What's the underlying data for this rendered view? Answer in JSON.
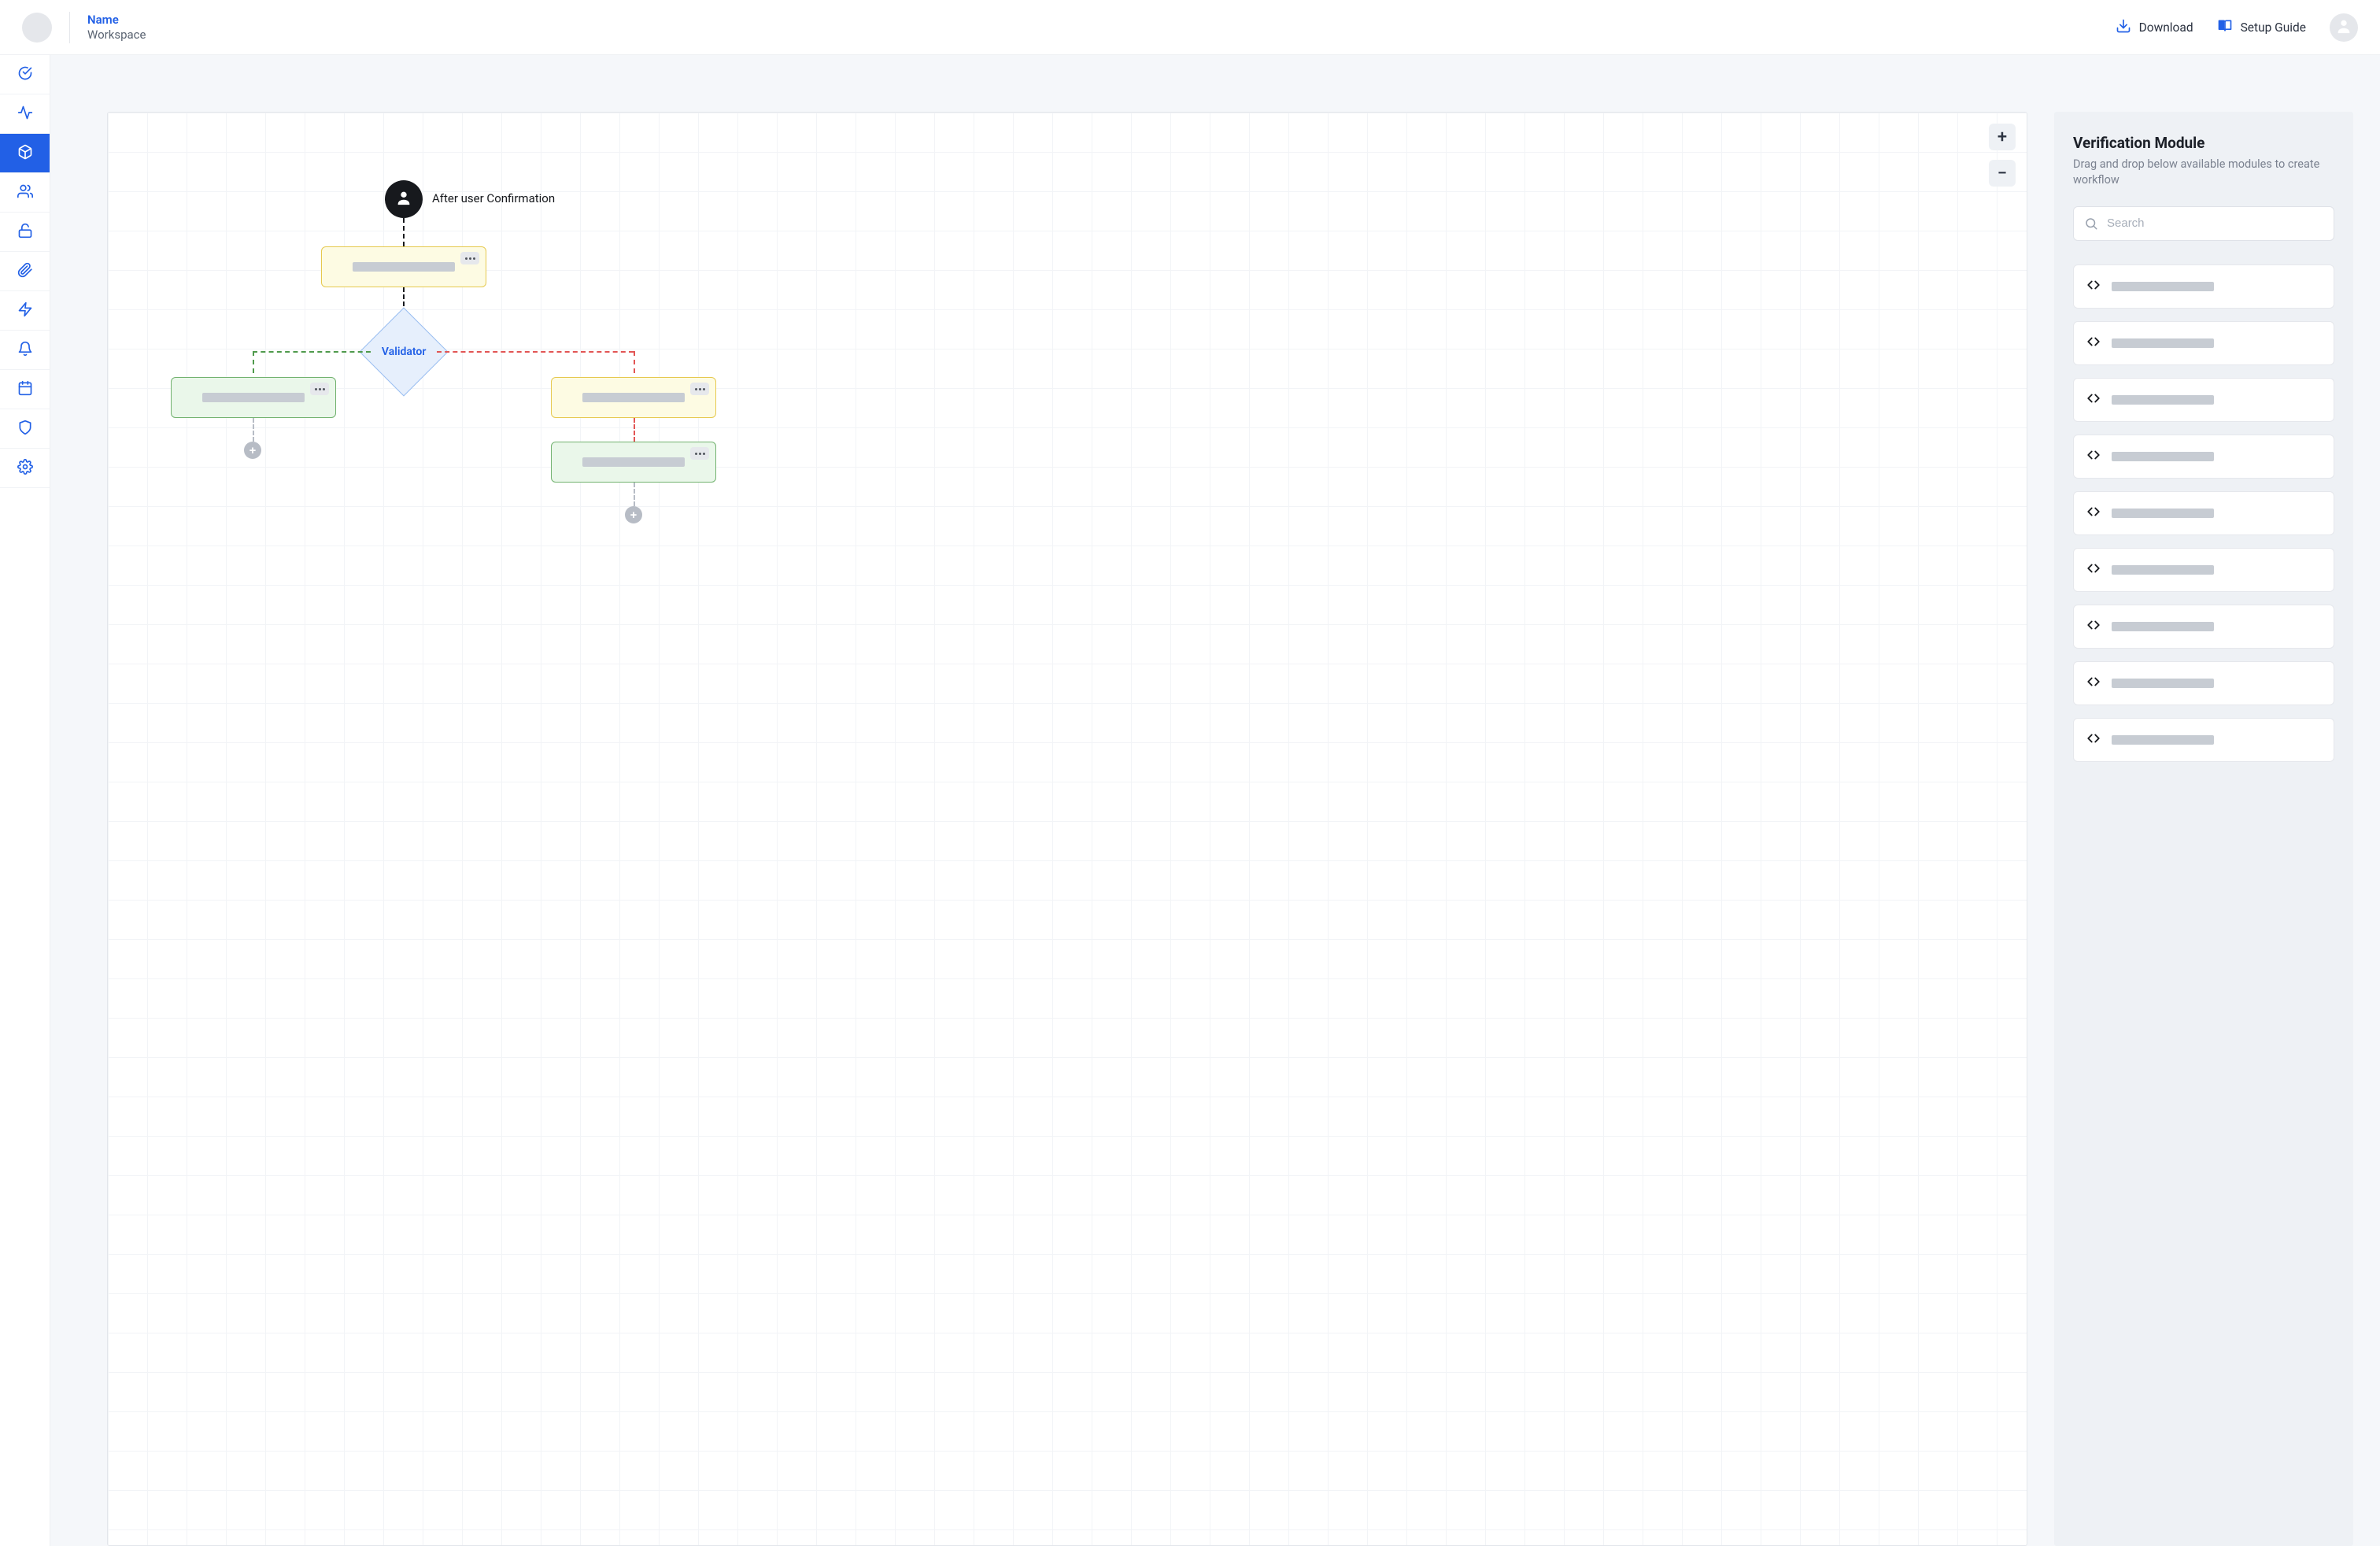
{
  "header": {
    "name_link": "Name",
    "workspace": "Workspace",
    "download": "Download",
    "setup_guide": "Setup Guide"
  },
  "sidebar": {
    "items": [
      {
        "icon": "check-circle-icon",
        "active": false
      },
      {
        "icon": "activity-icon",
        "active": false
      },
      {
        "icon": "cube-icon",
        "active": true
      },
      {
        "icon": "users-icon",
        "active": false
      },
      {
        "icon": "unlock-icon",
        "active": false
      },
      {
        "icon": "paperclip-icon",
        "active": false
      },
      {
        "icon": "bolt-icon",
        "active": false
      },
      {
        "icon": "bell-icon",
        "active": false
      },
      {
        "icon": "calendar-icon",
        "active": false
      },
      {
        "icon": "shield-icon",
        "active": false
      },
      {
        "icon": "gear-icon",
        "active": false
      }
    ]
  },
  "canvas": {
    "event_label": "After user Confirmation",
    "validator_label": "Validator",
    "zoom_in_label": "+",
    "zoom_out_label": "−"
  },
  "modules": {
    "title": "Verification Module",
    "subtitle": "Drag and drop below available modules to create workflow",
    "search_placeholder": "Search",
    "item_count": 9
  }
}
